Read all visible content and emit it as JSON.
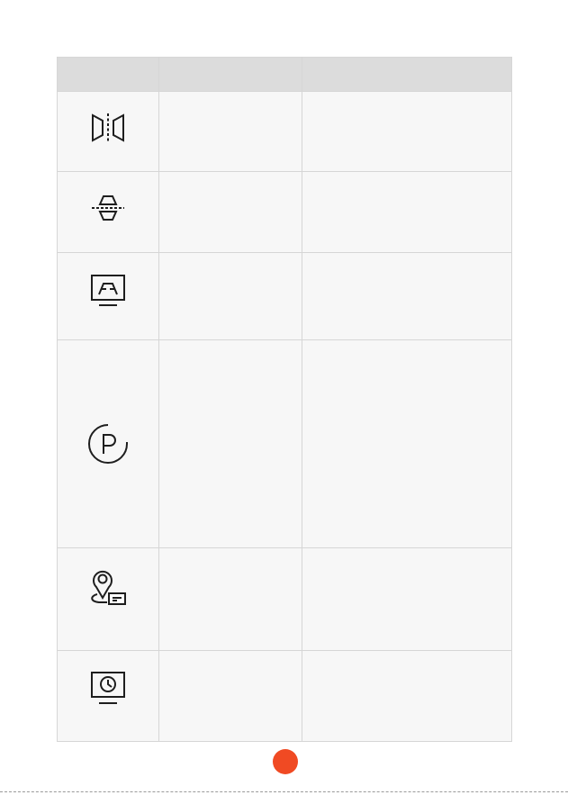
{
  "table": {
    "header": {
      "col1": "",
      "col2": "",
      "col3": ""
    },
    "rows": [
      {
        "icon": "mirror-view-icon",
        "name": "",
        "description": ""
      },
      {
        "icon": "flip-view-icon",
        "name": "",
        "description": ""
      },
      {
        "icon": "lane-display-icon",
        "name": "",
        "description": ""
      },
      {
        "icon": "parking-mode-icon",
        "name": "",
        "description": ""
      },
      {
        "icon": "location-card-icon",
        "name": "",
        "description": ""
      },
      {
        "icon": "time-display-icon",
        "name": "",
        "description": ""
      }
    ]
  },
  "page_indicator": {
    "color": "#f04a23"
  }
}
